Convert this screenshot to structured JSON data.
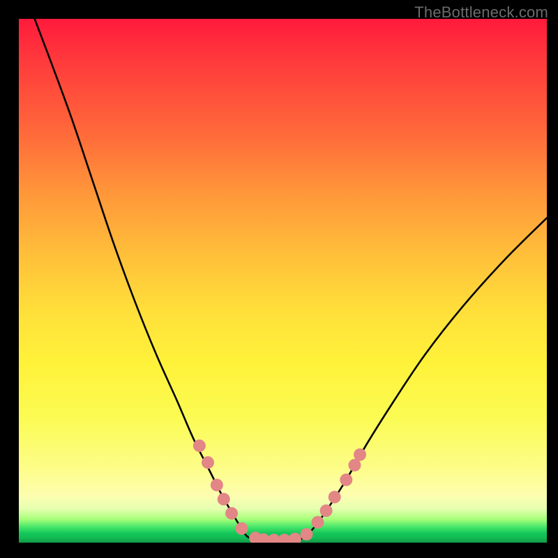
{
  "watermark": {
    "text": "TheBottleneck.com"
  },
  "chart_data": {
    "type": "line",
    "title": "",
    "xlabel": "",
    "ylabel": "",
    "xlim": [
      0,
      100
    ],
    "ylim": [
      0,
      100
    ],
    "grid": false,
    "legend": false,
    "background_gradient": {
      "orientation": "vertical",
      "stops": [
        {
          "pos": 0.0,
          "color": "#ff1a3c"
        },
        {
          "pos": 0.5,
          "color": "#ffd53a"
        },
        {
          "pos": 0.9,
          "color": "#fdfd8a"
        },
        {
          "pos": 0.97,
          "color": "#47e66a"
        },
        {
          "pos": 1.0,
          "color": "#0f9a44"
        }
      ]
    },
    "series": [
      {
        "name": "left-curve",
        "color": "#000000",
        "stroke_width": 2.5,
        "x": [
          3.0,
          6.0,
          10.0,
          14.0,
          18.0,
          22.0,
          26.0,
          30.0,
          33.0,
          36.0,
          38.5,
          40.5,
          42.0,
          43.5
        ],
        "y": [
          100.0,
          92.0,
          81.0,
          69.0,
          57.0,
          46.0,
          36.0,
          27.0,
          20.0,
          14.0,
          9.0,
          5.5,
          3.0,
          1.0
        ]
      },
      {
        "name": "flat-bottom",
        "color": "#000000",
        "stroke_width": 2.5,
        "x": [
          43.5,
          46.0,
          49.0,
          52.0,
          54.0
        ],
        "y": [
          1.0,
          0.5,
          0.5,
          0.5,
          1.0
        ]
      },
      {
        "name": "right-curve",
        "color": "#000000",
        "stroke_width": 2.5,
        "x": [
          54.0,
          56.0,
          58.5,
          62.0,
          66.0,
          71.0,
          77.0,
          84.0,
          92.0,
          100.0
        ],
        "y": [
          1.0,
          3.0,
          6.5,
          12.0,
          19.0,
          27.0,
          36.0,
          45.0,
          54.0,
          62.0
        ]
      }
    ],
    "markers": {
      "name": "data-dots",
      "color": "#e28686",
      "radius": 9,
      "points": [
        {
          "x": 34.2,
          "y": 18.5
        },
        {
          "x": 35.8,
          "y": 15.3
        },
        {
          "x": 37.5,
          "y": 11.0
        },
        {
          "x": 38.8,
          "y": 8.3
        },
        {
          "x": 40.3,
          "y": 5.6
        },
        {
          "x": 42.2,
          "y": 2.7
        },
        {
          "x": 44.8,
          "y": 0.9
        },
        {
          "x": 46.3,
          "y": 0.6
        },
        {
          "x": 48.3,
          "y": 0.5
        },
        {
          "x": 50.3,
          "y": 0.5
        },
        {
          "x": 52.3,
          "y": 0.7
        },
        {
          "x": 54.5,
          "y": 1.6
        },
        {
          "x": 56.6,
          "y": 3.9
        },
        {
          "x": 58.2,
          "y": 6.1
        },
        {
          "x": 59.8,
          "y": 8.7
        },
        {
          "x": 62.0,
          "y": 12.0
        },
        {
          "x": 63.6,
          "y": 14.8
        },
        {
          "x": 64.6,
          "y": 16.8
        }
      ]
    }
  }
}
